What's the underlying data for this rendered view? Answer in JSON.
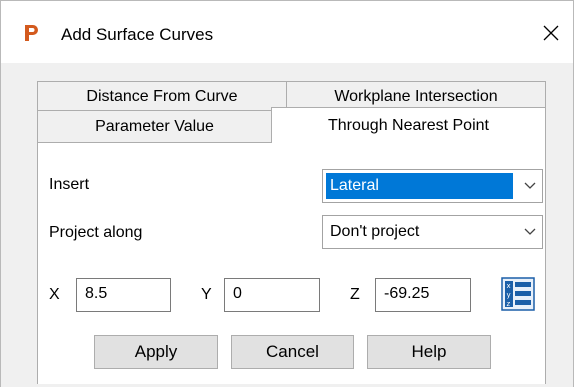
{
  "window": {
    "title": "Add Surface Curves",
    "icon": "app-p-icon",
    "close_icon": "close-icon"
  },
  "tabs": {
    "row_back": [
      {
        "label": "Distance From Curve"
      },
      {
        "label": "Workplane Intersection"
      }
    ],
    "row_front": [
      {
        "label": "Parameter Value"
      },
      {
        "label": "Through Nearest Point",
        "active": true
      }
    ]
  },
  "form": {
    "insert_label": "Insert",
    "insert_value": "Lateral",
    "project_label": "Project along",
    "project_value": "Don't project",
    "x_label": "X",
    "x_value": "8.5",
    "y_label": "Y",
    "y_value": "0",
    "z_label": "Z",
    "z_value": "-69.25",
    "calculator_icon": "xyz-calculator-icon"
  },
  "buttons": {
    "apply": "Apply",
    "cancel": "Cancel",
    "help": "Help"
  },
  "colors": {
    "selection": "#0078d7",
    "app_icon": "#d35a1e",
    "calc_icon": "#1b5fa8"
  }
}
